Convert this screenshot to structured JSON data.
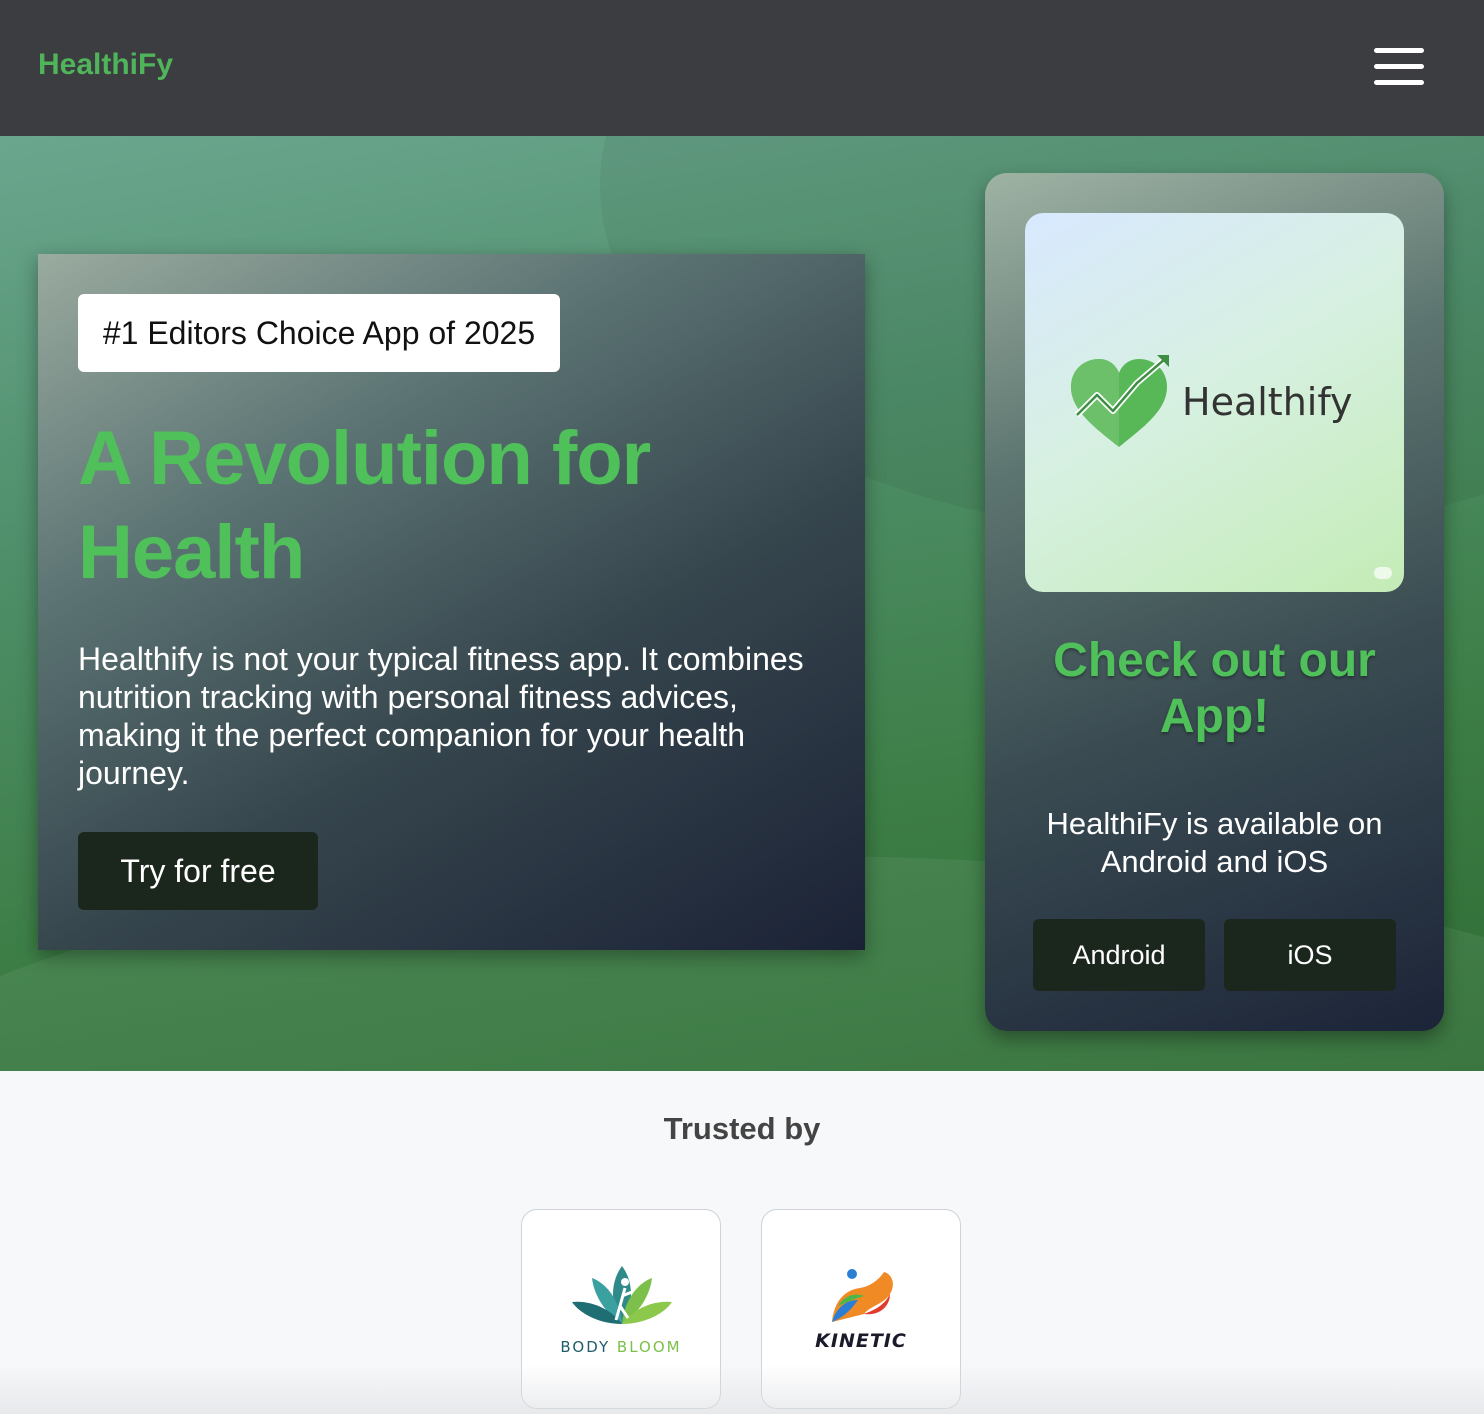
{
  "navbar": {
    "brand": "HealthiFy",
    "menu_icon": "hamburger-menu-icon"
  },
  "hero": {
    "badge": "#1 Editors Choice App of 2025",
    "headline": "A Revolution for Health",
    "description": "Healthify is not your typical fitness app. It combines nutrition tracking with personal fitness advices, making it the perfect companion for your health journey.",
    "cta_label": "Try for free"
  },
  "app_card": {
    "logo_text": "Healthify",
    "logo_icon": "heart-with-growth-arrow-icon",
    "heading": "Check out our App!",
    "text": "HealthiFy is available on Android and iOS",
    "android_label": "Android",
    "ios_label": "iOS"
  },
  "trusted": {
    "title": "Trusted by",
    "partners": [
      {
        "name_part1": "BODY",
        "name_part2": "BLOOM",
        "icon": "lotus-figure-icon"
      },
      {
        "name": "KINETIC",
        "icon": "flexed-arm-icon"
      }
    ]
  },
  "colors": {
    "brand_green": "#4fb45a",
    "navbar_bg": "#3b3d40",
    "button_dark": "#1b261d"
  }
}
